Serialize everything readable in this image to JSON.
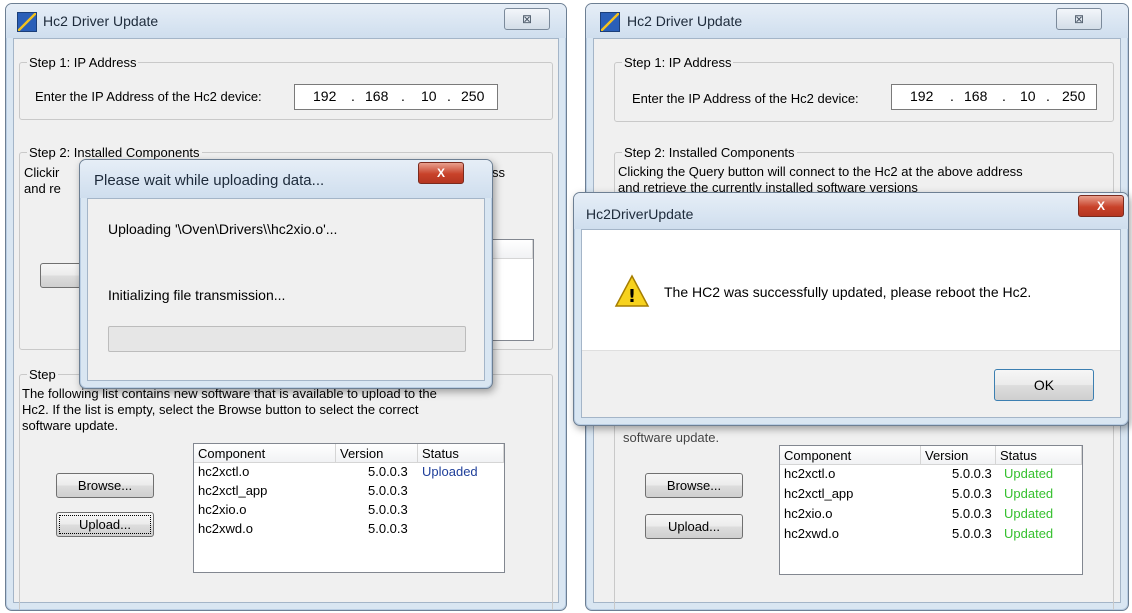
{
  "app": {
    "title": "Hc2 Driver Update",
    "close_glyph": "⊠",
    "step1_legend": "Step 1: IP Address",
    "ip_label": "Enter the IP Address of the Hc2 device:",
    "ip": [
      "192",
      "168",
      "10",
      "250"
    ],
    "ip_dot": ".",
    "step2_legend": "Step 2: Installed Components",
    "step2_text_line1": "Clicking the Query button will connect to the Hc2 at the above address",
    "step2_text_line2": "and retrieve the currently installed software versions",
    "step2_text_left_clip": "Clickir",
    "step2_text_left_clip2": "and re",
    "step2_text_right_clip": "ss",
    "step3_legend_clip": "Step",
    "step3_text_line1": "The following list contains new software that is available to upload to the",
    "step3_text_line2": "Hc2.  If the list is empty, select the Browse button to select the correct",
    "step3_text_line3": "software update.",
    "step3_text_line3_clip": "software update.",
    "browse_label": "Browse...",
    "upload_label": "Upload...",
    "columns": [
      "Component",
      "Version",
      "Status"
    ]
  },
  "left": {
    "rows": [
      {
        "component": "hc2xctl.o",
        "version": "5.0.0.3",
        "status": "Uploaded"
      },
      {
        "component": "hc2xctl_app",
        "version": "5.0.0.3",
        "status": ""
      },
      {
        "component": "hc2xio.o",
        "version": "5.0.0.3",
        "status": ""
      },
      {
        "component": "hc2xwd.o",
        "version": "5.0.0.3",
        "status": ""
      }
    ],
    "progress_dialog": {
      "title": "Please wait while uploading data...",
      "close_glyph": "X",
      "uploading_text": "Uploading '\\Oven\\Drivers\\\\hc2xio.o'...",
      "status_text": "Initializing file transmission...",
      "progress": 0
    }
  },
  "right": {
    "rows": [
      {
        "component": "hc2xctl.o",
        "version": "5.0.0.3",
        "status": "Updated"
      },
      {
        "component": "hc2xctl_app",
        "version": "5.0.0.3",
        "status": "Updated"
      },
      {
        "component": "hc2xio.o",
        "version": "5.0.0.3",
        "status": "Updated"
      },
      {
        "component": "hc2xwd.o",
        "version": "5.0.0.3",
        "status": "Updated"
      }
    ],
    "message_box": {
      "title": "Hc2DriverUpdate",
      "close_glyph": "X",
      "warning_glyph": "!",
      "message": "The HC2 was successfully updated, please reboot the Hc2.",
      "ok_label": "OK"
    }
  },
  "colors": {
    "uploaded_status": "#1f3f9a",
    "updated_status": "#35c02e"
  }
}
